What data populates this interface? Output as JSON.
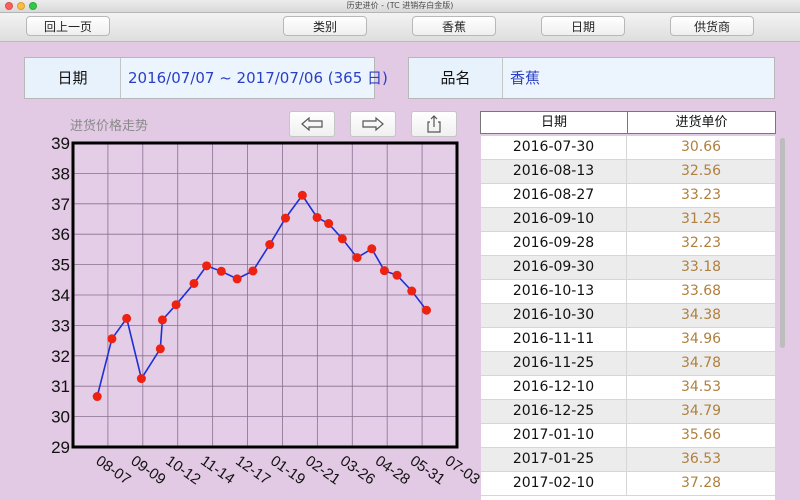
{
  "window": {
    "title": "历史进价 - (TC 进销存白金版)"
  },
  "toolbar": {
    "prev_page": "回上一页",
    "category": "类别",
    "product": "香蕉",
    "date": "日期",
    "supplier": "供货商"
  },
  "info": {
    "date_label": "日期",
    "date_value": "2016/07/07 ~ 2017/07/06  (365 日)",
    "product_label": "品名",
    "product_value": "香蕉"
  },
  "chart_title": "进货价格走势",
  "chart_nav": {
    "back_icon": "arrow-left-icon",
    "forward_icon": "arrow-right-icon",
    "share_icon": "share-icon"
  },
  "chart_data": {
    "type": "line",
    "title": "进货价格走势",
    "xlabel": "",
    "ylabel": "",
    "ylim": [
      29,
      39
    ],
    "yticks": [
      29,
      30,
      31,
      32,
      33,
      34,
      35,
      36,
      37,
      38,
      39
    ],
    "xticks": [
      "08-07",
      "09-09",
      "10-12",
      "11-14",
      "12-17",
      "01-19",
      "02-21",
      "03-26",
      "04-28",
      "05-31",
      "07-03"
    ],
    "x": [
      "2016-07-30",
      "2016-08-13",
      "2016-08-27",
      "2016-09-10",
      "2016-09-28",
      "2016-09-30",
      "2016-10-13",
      "2016-10-30",
      "2016-11-11",
      "2016-11-25",
      "2016-12-10",
      "2016-12-25",
      "2017-01-10",
      "2017-01-25",
      "2017-02-10",
      "2017-02-24",
      "2017-03-07",
      "2017-03-20",
      "2017-04-03",
      "2017-04-17",
      "2017-04-29",
      "2017-05-11",
      "2017-05-25",
      "2017-06-08"
    ],
    "values": [
      30.66,
      32.56,
      33.23,
      31.25,
      32.23,
      33.18,
      33.68,
      34.38,
      34.96,
      34.78,
      34.53,
      34.79,
      35.66,
      36.53,
      37.28,
      36.55,
      36.35,
      35.85,
      35.23,
      35.52,
      34.8,
      34.65,
      34.13,
      33.5
    ],
    "grid": true,
    "colors": {
      "line": "#1f2fd6",
      "marker": "#ee2211"
    }
  },
  "table": {
    "columns": [
      "日期",
      "进货单价"
    ],
    "rows": [
      [
        "2016-07-30",
        "30.66"
      ],
      [
        "2016-08-13",
        "32.56"
      ],
      [
        "2016-08-27",
        "33.23"
      ],
      [
        "2016-09-10",
        "31.25"
      ],
      [
        "2016-09-28",
        "32.23"
      ],
      [
        "2016-09-30",
        "33.18"
      ],
      [
        "2016-10-13",
        "33.68"
      ],
      [
        "2016-10-30",
        "34.38"
      ],
      [
        "2016-11-11",
        "34.96"
      ],
      [
        "2016-11-25",
        "34.78"
      ],
      [
        "2016-12-10",
        "34.53"
      ],
      [
        "2016-12-25",
        "34.79"
      ],
      [
        "2017-01-10",
        "35.66"
      ],
      [
        "2017-01-25",
        "36.53"
      ],
      [
        "2017-02-10",
        "37.28"
      ]
    ]
  },
  "colors": {
    "background": "#e2c9e4",
    "accent_text": "#2a3fc5",
    "price_text": "#b08040"
  }
}
